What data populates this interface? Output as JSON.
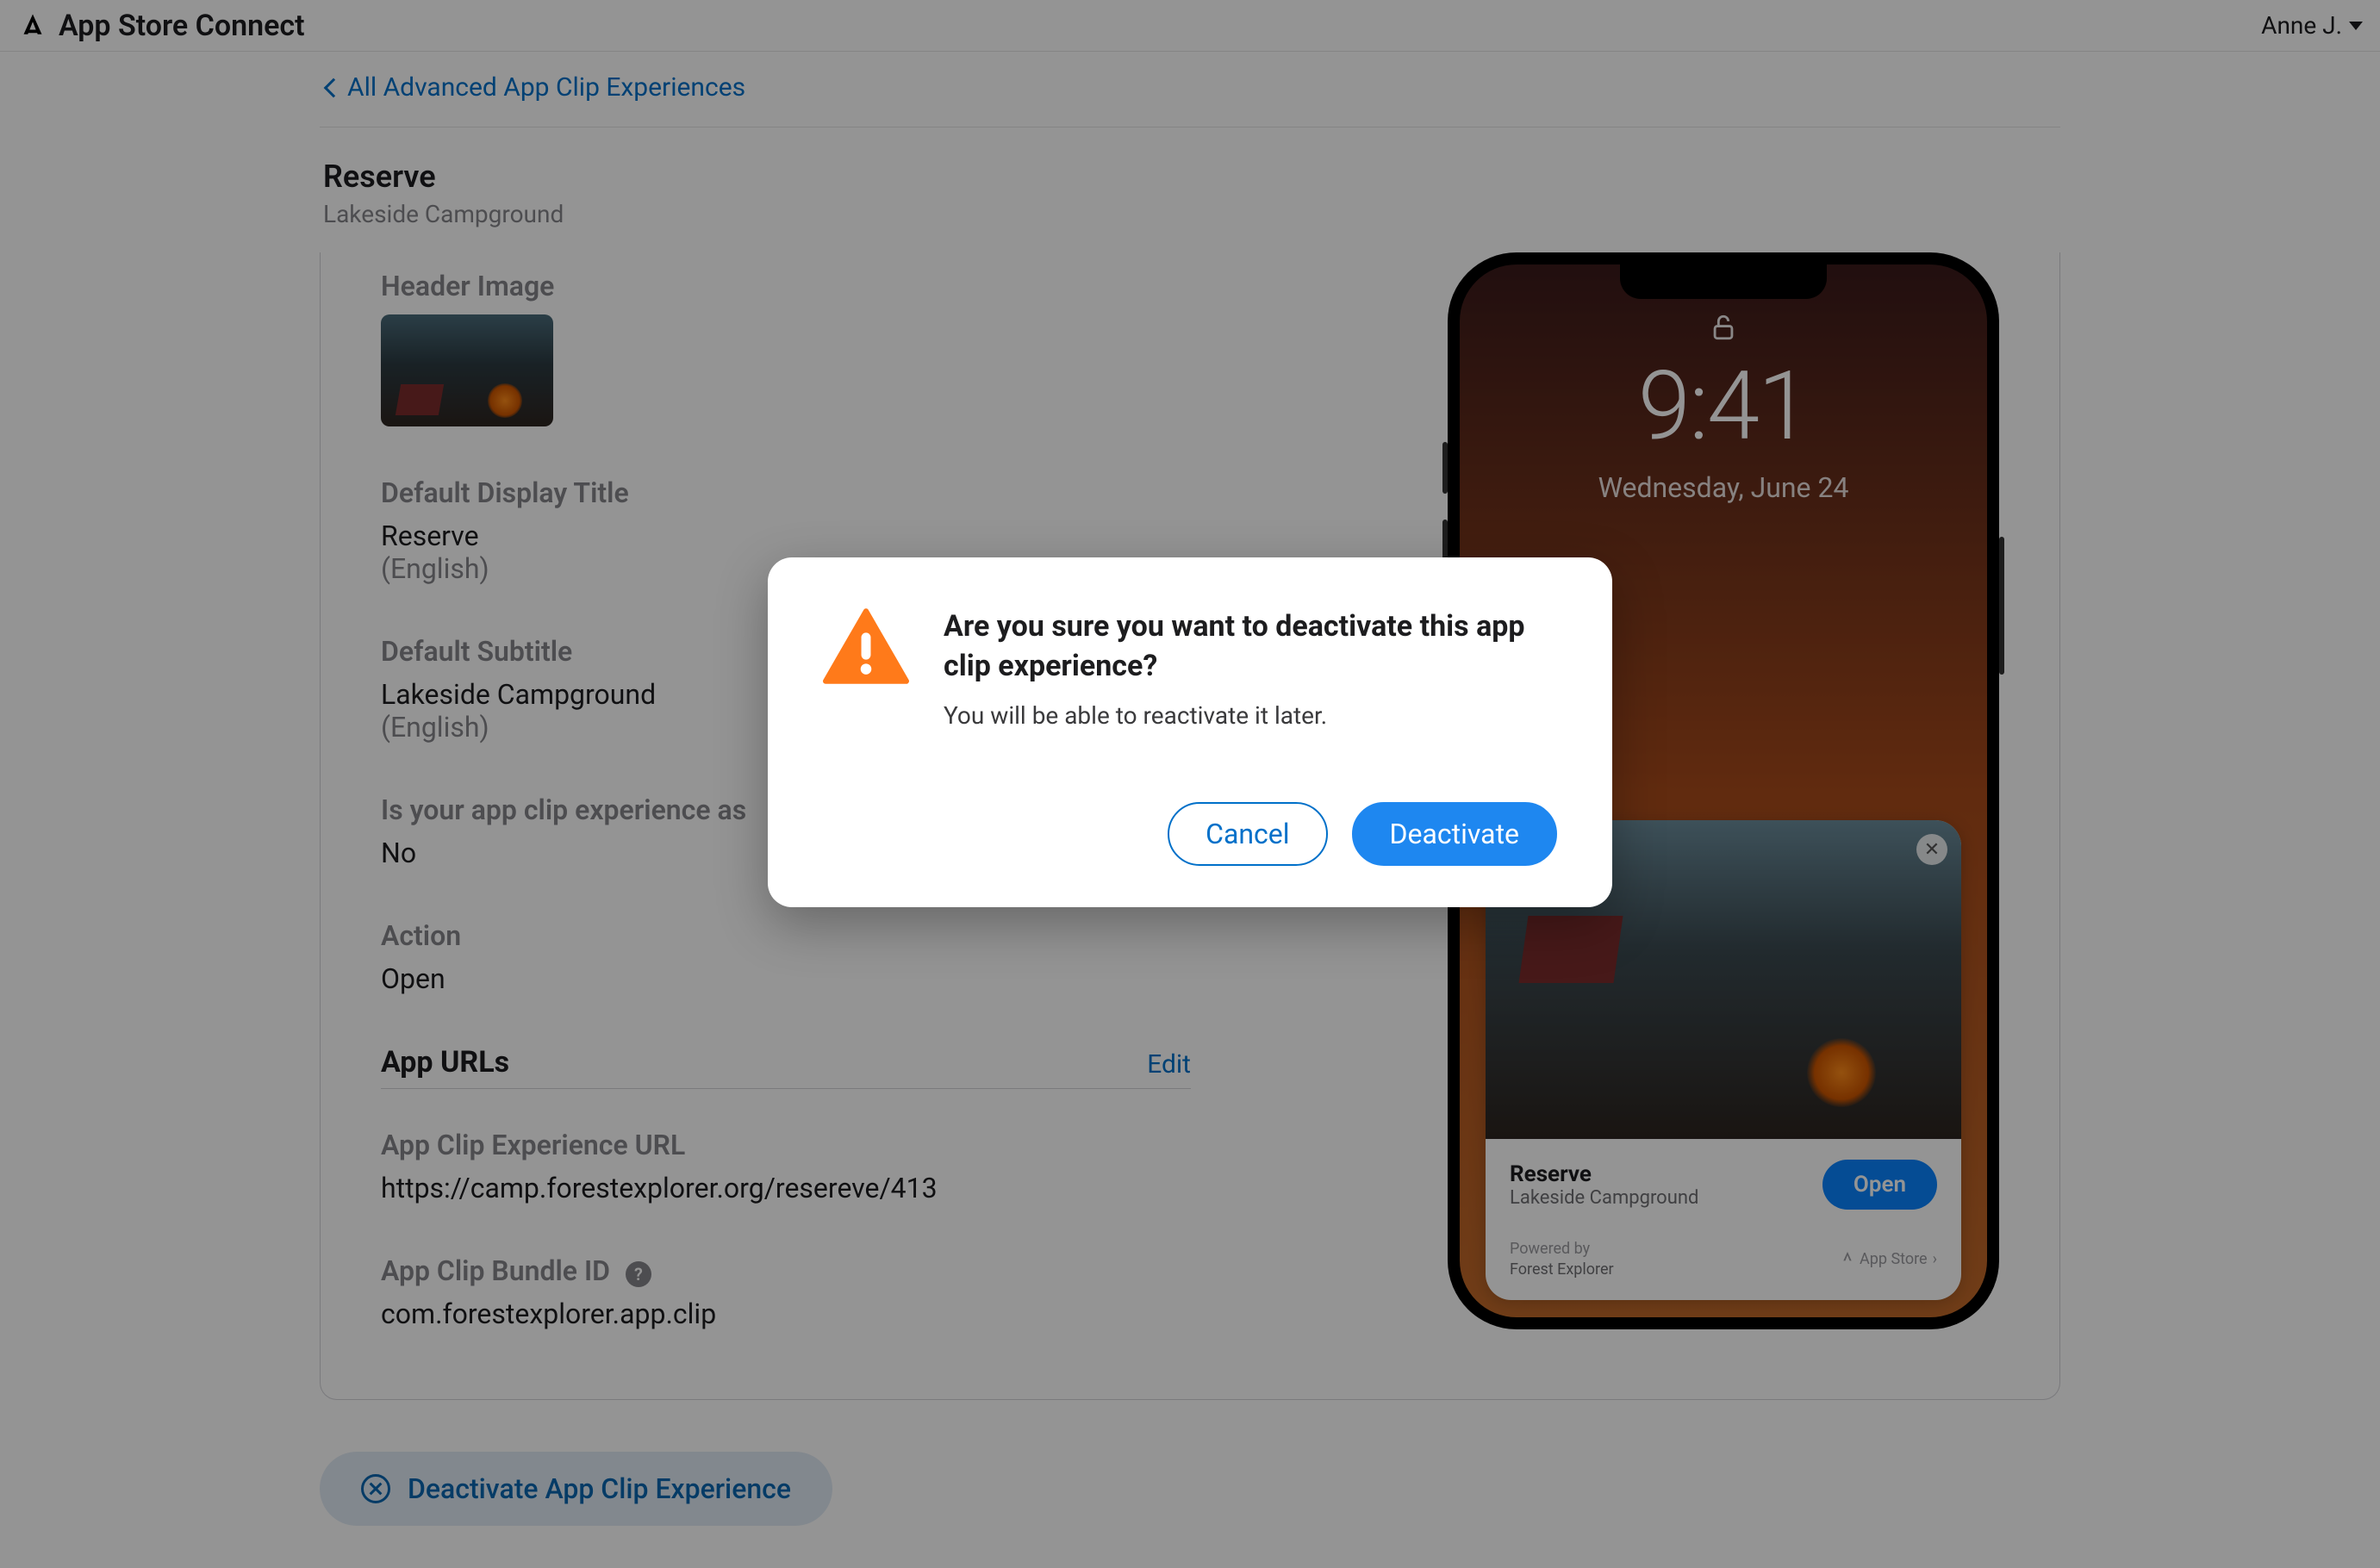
{
  "header": {
    "app_name": "App Store Connect",
    "user_name": "Anne J."
  },
  "breadcrumb": {
    "back_label": "All Advanced App Clip Experiences"
  },
  "page": {
    "title": "Reserve",
    "subtitle": "Lakeside Campground"
  },
  "fields": {
    "header_image_label": "Header Image",
    "display_title_label": "Default Display Title",
    "display_title_value": "Reserve",
    "display_title_lang": "(English)",
    "subtitle_label": "Default Subtitle",
    "subtitle_value": "Lakeside Campground",
    "subtitle_lang": "(English)",
    "association_label": "Is your app clip experience as",
    "association_value": "No",
    "action_label": "Action",
    "action_value": "Open",
    "app_urls_heading": "App URLs",
    "edit_label": "Edit",
    "experience_url_label": "App Clip Experience URL",
    "experience_url_value": "https://camp.forestexplorer.org/resereve/413",
    "bundle_id_label": "App Clip Bundle ID",
    "bundle_id_value": "com.forestexplorer.app.clip"
  },
  "preview": {
    "time": "9:41",
    "date": "Wednesday, June 24",
    "card_title": "Reserve",
    "card_subtitle": "Lakeside Campground",
    "open_label": "Open",
    "powered_by_label": "Powered by",
    "app_name": "Forest Explorer",
    "store_label": "App Store"
  },
  "deactivate": {
    "button_label": "Deactivate App Clip Experience"
  },
  "modal": {
    "title": "Are you sure you want to deactivate this app clip experience?",
    "subtitle": "You will be able to reactivate it later.",
    "cancel_label": "Cancel",
    "confirm_label": "Deactivate"
  }
}
